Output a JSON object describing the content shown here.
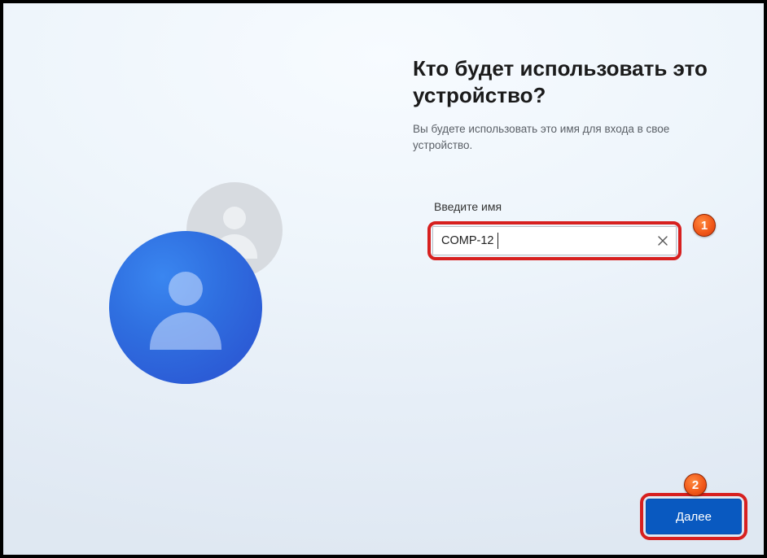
{
  "title": "Кто будет использовать это устройство?",
  "subtitle": "Вы будете использовать это имя для входа в свое устройство.",
  "field_label": "Введите имя",
  "name_value": "COMP-12",
  "clear_icon_name": "close-icon",
  "next_label": "Далее",
  "callouts": {
    "one": "1",
    "two": "2"
  }
}
